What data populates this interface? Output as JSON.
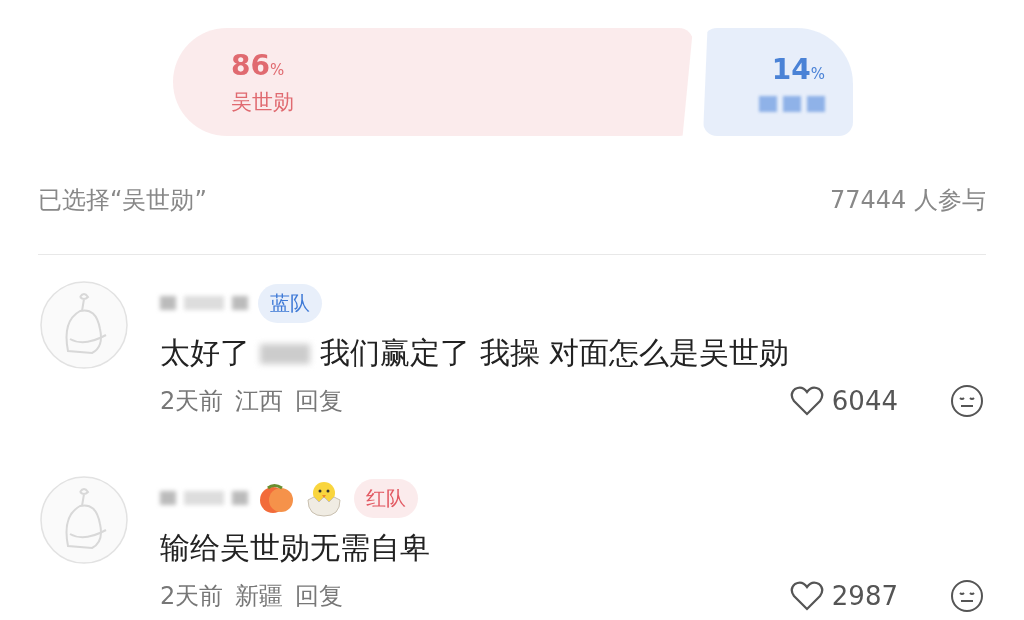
{
  "poll": {
    "options": [
      {
        "percent": "86",
        "unit": "%",
        "label": "吴世勋",
        "color": "#e06a70"
      },
      {
        "percent": "14",
        "unit": "%",
        "color": "#4a82d6"
      }
    ]
  },
  "selection": {
    "text": "已选择“吴世勋”",
    "participants": "77444 人参与"
  },
  "comments": [
    {
      "team": "蓝队",
      "color": "#3f7ad6",
      "text_parts": [
        "太好了",
        "我们赢定了 我操 对面怎么是吴世勋"
      ],
      "time": "2天前",
      "location": "江西",
      "reply": "回复",
      "likes": "6044"
    },
    {
      "team": "红队",
      "color": "#e25962",
      "text_parts": [
        "输给吴世勋无需自卑"
      ],
      "time": "2天前",
      "location": "新疆",
      "reply": "回复",
      "likes": "2987",
      "name_emojis": [
        {
          "kind": "peach"
        },
        {
          "kind": "chick"
        }
      ]
    }
  ]
}
